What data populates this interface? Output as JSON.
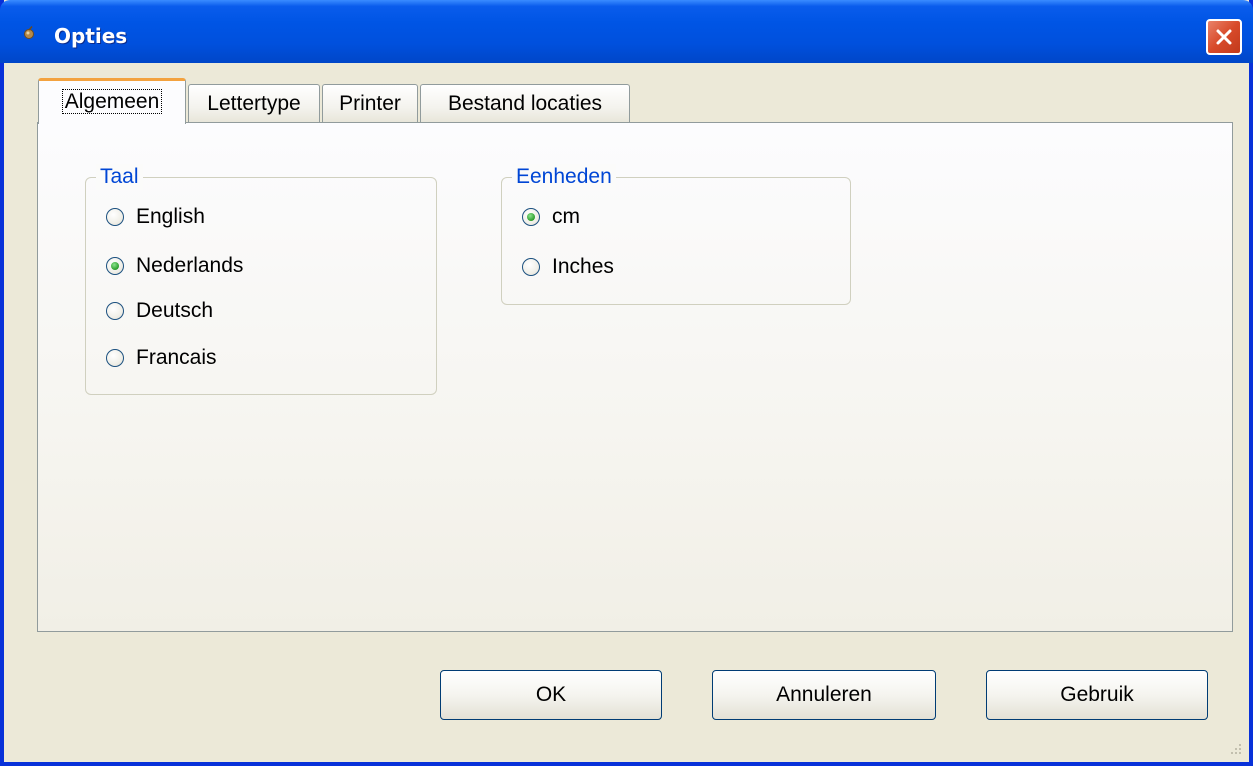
{
  "window": {
    "title": "Opties",
    "icon": "app-icon",
    "close_icon": "close-icon"
  },
  "tabs": [
    {
      "label": "Algemeen",
      "active": true
    },
    {
      "label": "Lettertype",
      "active": false
    },
    {
      "label": "Printer",
      "active": false
    },
    {
      "label": "Bestand locaties",
      "active": false
    }
  ],
  "groups": {
    "taal": {
      "legend": "Taal",
      "options": [
        {
          "label": "English",
          "checked": false
        },
        {
          "label": "Nederlands",
          "checked": true
        },
        {
          "label": "Deutsch",
          "checked": false
        },
        {
          "label": "Francais",
          "checked": false
        }
      ]
    },
    "eenheden": {
      "legend": "Eenheden",
      "options": [
        {
          "label": "cm",
          "checked": true
        },
        {
          "label": "Inches",
          "checked": false
        }
      ]
    }
  },
  "buttons": {
    "ok": "OK",
    "cancel": "Annuleren",
    "apply": "Gebruik"
  },
  "colors": {
    "titlebar": "#0055e5",
    "legend_text": "#0046d5",
    "active_tab_accent": "#f3a23f",
    "radio_dot": "#2a9d2a"
  }
}
